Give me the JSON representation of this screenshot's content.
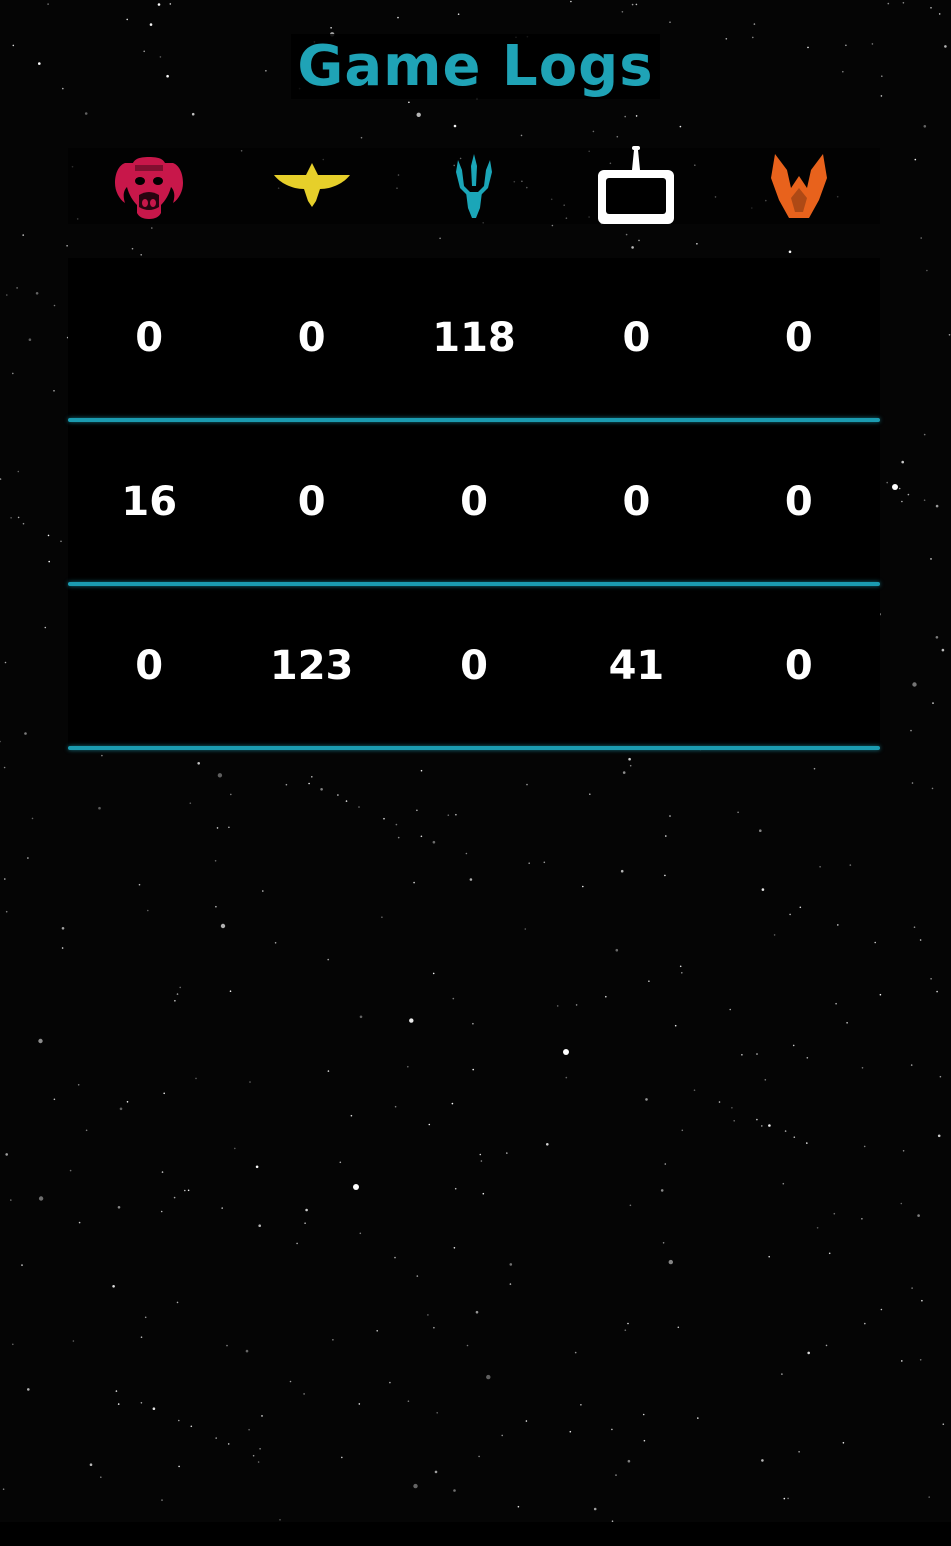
{
  "title": "Game Logs",
  "colors": {
    "title": "#1fa3b6",
    "divider": "#1b9bb0",
    "faction_red": "#c8174a",
    "faction_yellow": "#e6cf2a",
    "faction_teal": "#1ba6b8",
    "faction_white": "#ffffff",
    "faction_orange": "#e8621c"
  },
  "factions": [
    {
      "icon": "boar-skull-icon",
      "color": "#c8174a"
    },
    {
      "icon": "eagle-icon",
      "color": "#e6cf2a"
    },
    {
      "icon": "trident-claw-icon",
      "color": "#1ba6b8"
    },
    {
      "icon": "robot-screen-icon",
      "color": "#ffffff"
    },
    {
      "icon": "flame-claw-icon",
      "color": "#e8621c"
    }
  ],
  "logs": [
    [
      "0",
      "0",
      "118",
      "0",
      "0"
    ],
    [
      "16",
      "0",
      "0",
      "0",
      "0"
    ],
    [
      "0",
      "123",
      "0",
      "41",
      "0"
    ]
  ]
}
